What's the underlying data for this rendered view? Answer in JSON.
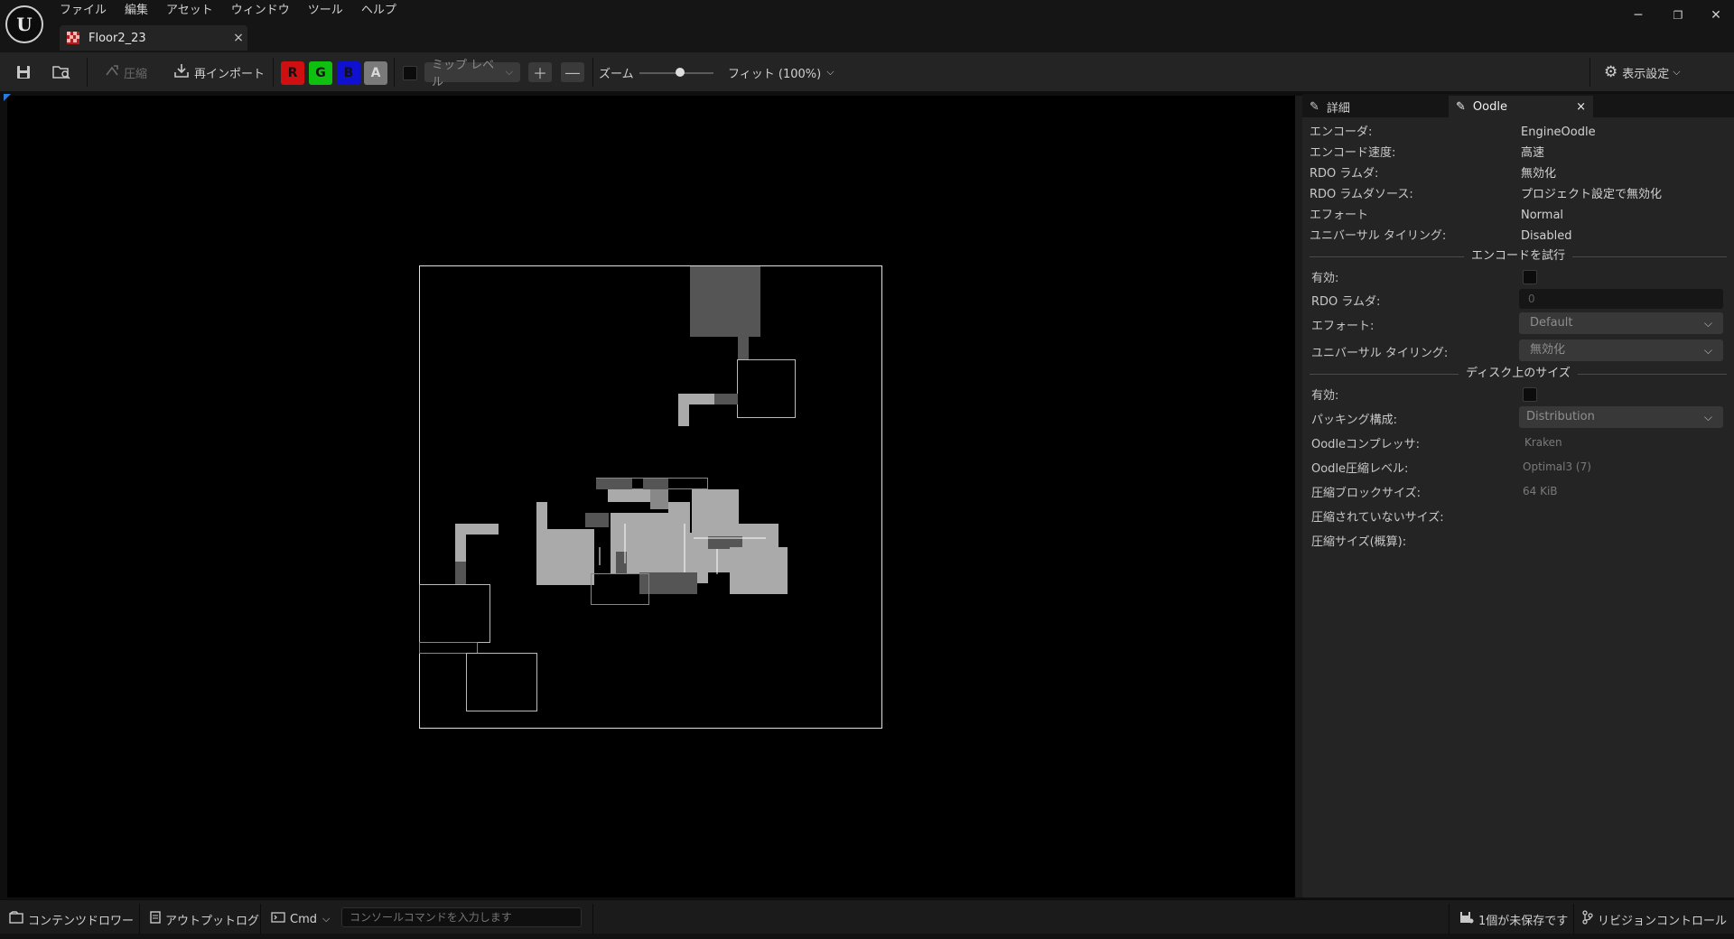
{
  "app": {
    "logo_letter": "U"
  },
  "menu": [
    "ファイル",
    "編集",
    "アセット",
    "ウィンドウ",
    "ツール",
    "ヘルプ"
  ],
  "document_tab": {
    "title": "Floor2_23",
    "close": "×"
  },
  "window_controls": {
    "minimize": "─",
    "restore": "❐",
    "close": "✕"
  },
  "toolbar": {
    "compress_label": "圧縮",
    "reimport_label": "再インポート",
    "channels": {
      "r": "R",
      "g": "G",
      "b": "B",
      "a": "A"
    },
    "channel_colors": {
      "r": "#d01010",
      "g": "#10c010",
      "b": "#1010d0",
      "a": "#7a7a7a"
    },
    "mip_level_label": "ミップ レベル",
    "zoom_label": "ズーム",
    "zoom_value": "フィット (100%)",
    "zoom_slider_fraction": 0.55,
    "view_settings_label": "表示設定"
  },
  "details": {
    "tabs": {
      "details": "詳細",
      "oodle": "Oodle",
      "close": "×"
    },
    "info_rows": [
      {
        "label": "エンコーダ:",
        "value": "EngineOodle"
      },
      {
        "label": "エンコード速度:",
        "value": "高速"
      },
      {
        "label": "RDO ラムダ:",
        "value": "無効化"
      },
      {
        "label": "RDO ラムダソース:",
        "value": "プロジェクト設定で無効化"
      },
      {
        "label": "エフォート",
        "value": "Normal"
      },
      {
        "label": "ユニバーサル タイリング:",
        "value": "Disabled"
      }
    ],
    "try_encode": {
      "title": "エンコードを試行",
      "enabled_label": "有効:",
      "rdo_lambda_label": "RDO ラムダ:",
      "rdo_lambda_value": "0",
      "effort_label": "エフォート:",
      "effort_value": "Default",
      "tiling_label": "ユニバーサル タイリング:",
      "tiling_value": "無効化"
    },
    "disk_size": {
      "title": "ディスク上のサイズ",
      "enabled_label": "有効:",
      "packaging_label": "パッキング構成:",
      "packaging_value": "Distribution",
      "compressor_label": "Oodleコンプレッサ:",
      "compressor_value": "Kraken",
      "level_label": "Oodle圧縮レベル:",
      "level_value": "Optimal3 (7)",
      "block_label": "圧縮ブロックサイズ:",
      "block_value": "64 KiB",
      "uncompressed_label": "圧縮されていないサイズ:",
      "compressed_label": "圧縮サイズ(概算):"
    }
  },
  "statusbar": {
    "content_drawer": "コンテンツドロワー",
    "output_log": "アウトプットログ",
    "cmd": "Cmd",
    "console_placeholder": "コンソールコマンドを入力します",
    "unsaved": "1個が未保存です",
    "revision_control": "リビジョンコントロール"
  }
}
